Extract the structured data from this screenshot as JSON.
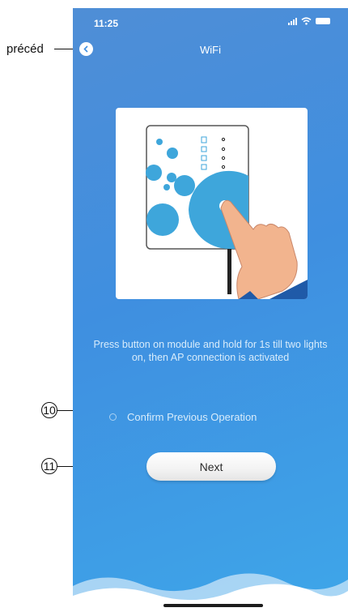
{
  "status_bar": {
    "time": "11:25"
  },
  "nav": {
    "title": "WiFi"
  },
  "instruction": "Press button on module and hold for 1s till two lights on, then AP connection is activated",
  "confirm": {
    "label": "Confirm Previous Operation",
    "checked": false
  },
  "next_button": {
    "label": "Next"
  },
  "annotations": {
    "back_label": "précéd",
    "confirm_number": "10",
    "next_number": "11"
  },
  "colors": {
    "background_top": "#4f8ed6",
    "background_bottom": "#3ea6e9",
    "circle_accent": "#3ea6db",
    "hand": "#f2b48e"
  }
}
